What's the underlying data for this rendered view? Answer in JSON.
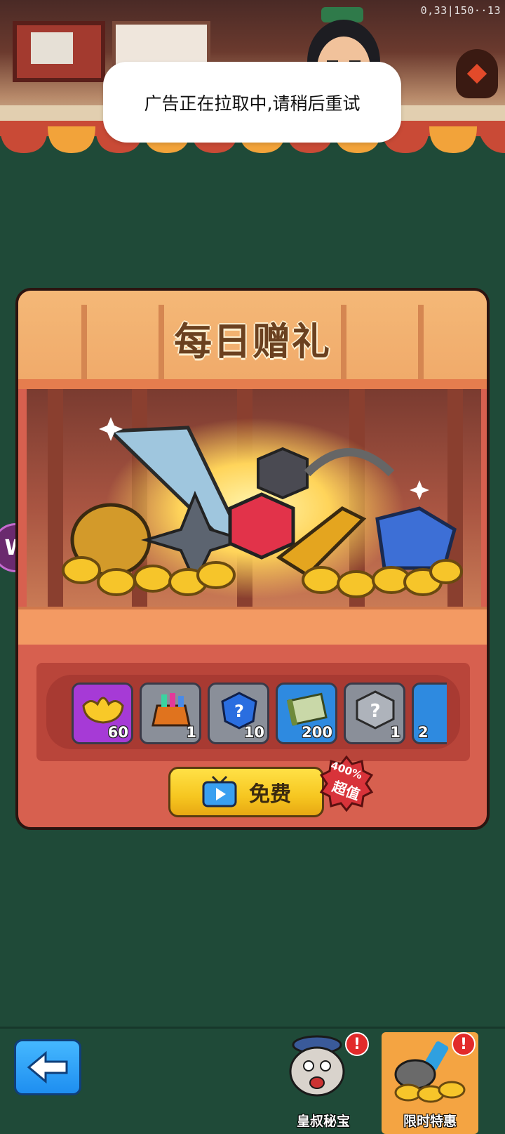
{
  "status": {
    "debug_text": "0,33|150··13"
  },
  "toast": {
    "message": "广告正在拉取中,请稍后重试"
  },
  "side_badge": {
    "letter": "W"
  },
  "shop": {
    "title": "每日赠礼",
    "items": [
      {
        "name": "gold-ingot",
        "count": "60",
        "color": "#a63ad6"
      },
      {
        "name": "gift-bag",
        "count": "1",
        "color": "#8a8f99"
      },
      {
        "name": "blue-mystery-gem",
        "count": "10",
        "color": "#8a8f99"
      },
      {
        "name": "scroll",
        "count": "200",
        "color": "#2e8ae0"
      },
      {
        "name": "mystery-box",
        "count": "1",
        "color": "#8a8f99"
      },
      {
        "name": "partial-item",
        "count": "2",
        "color": "#2e8ae0"
      }
    ],
    "free_button": {
      "label": "免费"
    },
    "value_badge": {
      "line1": "400%",
      "line2": "超值"
    }
  },
  "bottom_nav": {
    "tabs": [
      {
        "label": "皇叔秘宝",
        "alert": "!"
      },
      {
        "label": "限时特惠",
        "alert": "!"
      }
    ]
  },
  "colors": {
    "background": "#1f4a38",
    "panel": "#d7604f",
    "accent": "#f6c620"
  }
}
